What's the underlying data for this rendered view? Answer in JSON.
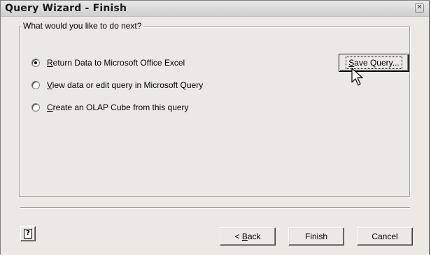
{
  "window": {
    "title": "Query Wizard - Finish",
    "close_glyph": "✕"
  },
  "group": {
    "legend": "What would you like to do next?",
    "options": [
      {
        "prefix": "",
        "accel": "R",
        "rest": "eturn Data to Microsoft Office Excel",
        "checked": true
      },
      {
        "prefix": "",
        "accel": "V",
        "rest": "iew data or edit query in Microsoft Query",
        "checked": false
      },
      {
        "prefix": "",
        "accel": "C",
        "rest": "reate an OLAP Cube from this query",
        "checked": false
      }
    ]
  },
  "buttons": {
    "save_query": {
      "accel": "S",
      "rest": "ave Query..."
    },
    "back": {
      "prefix": "< ",
      "accel": "B",
      "rest": "ack"
    },
    "finish": "Finish",
    "cancel": "Cancel",
    "help_glyph": "?"
  },
  "icons": {
    "pointer": "mouse-pointer-icon",
    "help": "help-icon",
    "close": "close-icon"
  }
}
